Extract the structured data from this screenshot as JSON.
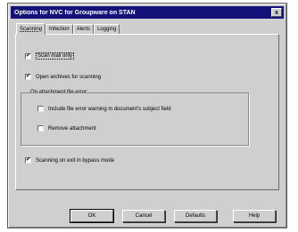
{
  "window": {
    "title": "Options for NVC for Groupware on STAN",
    "close_glyph": "x"
  },
  "tabs": [
    {
      "label": "Scanning",
      "active": true
    },
    {
      "label": "Infection",
      "active": false
    },
    {
      "label": "Alerts",
      "active": false
    },
    {
      "label": "Logging",
      "active": false
    }
  ],
  "scanning": {
    "scan_mail_only": {
      "label": "Scan mail only",
      "checked": true
    },
    "open_archives": {
      "label": "Open archives for scanning",
      "checked": true
    },
    "group_label": "On attachment file error:",
    "include_file_error": {
      "label": "Include file error warning in document's subject field",
      "checked": false
    },
    "remove_attachment": {
      "label": "Remove attachment",
      "checked": false
    },
    "scanning_on_exit": {
      "label": "Scanning on exit in bypass mode",
      "checked": true
    }
  },
  "buttons": {
    "ok": "OK",
    "cancel": "Cancel",
    "defaults": "Defaults",
    "help": "Help"
  }
}
